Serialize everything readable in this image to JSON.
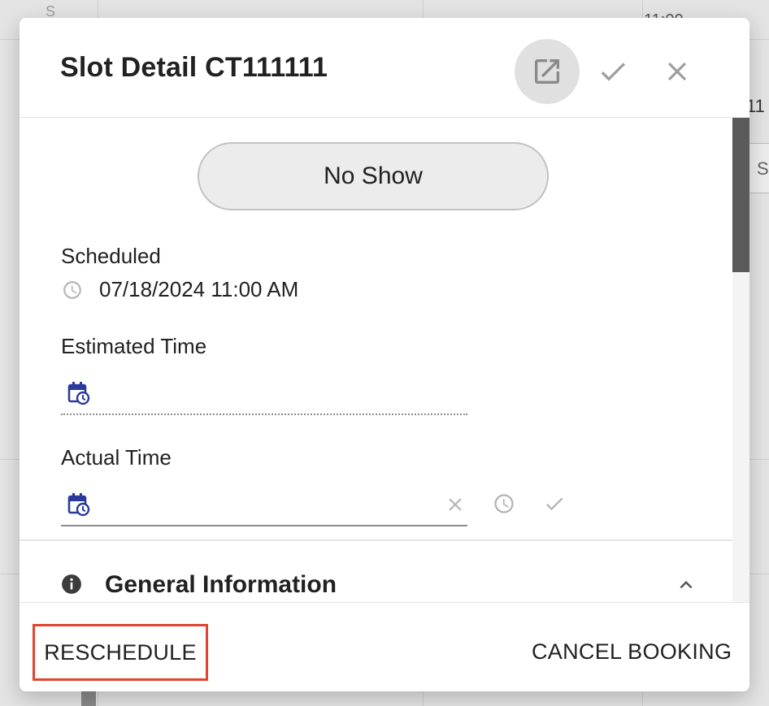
{
  "background": {
    "day_letter": "S",
    "time_top": "11:00",
    "time_right": "11",
    "chip_letter": "S"
  },
  "dialog": {
    "title": "Slot Detail CT111111",
    "header_icons": [
      "open-in-new-icon",
      "check-icon",
      "close-icon"
    ],
    "status_button": "No Show",
    "scheduled": {
      "label": "Scheduled",
      "value": "07/18/2024 11:00 AM"
    },
    "estimated_time": {
      "label": "Estimated Time",
      "value": ""
    },
    "actual_time": {
      "label": "Actual Time",
      "value": ""
    },
    "general_information": {
      "title": "General Information"
    },
    "footer": {
      "reschedule": "RESCHEDULE",
      "cancel_booking": "CANCEL BOOKING"
    }
  },
  "colors": {
    "accent_blue": "#2a3a9c",
    "highlight_red": "#e2442f",
    "scrollbar": "#5a5a5a"
  }
}
